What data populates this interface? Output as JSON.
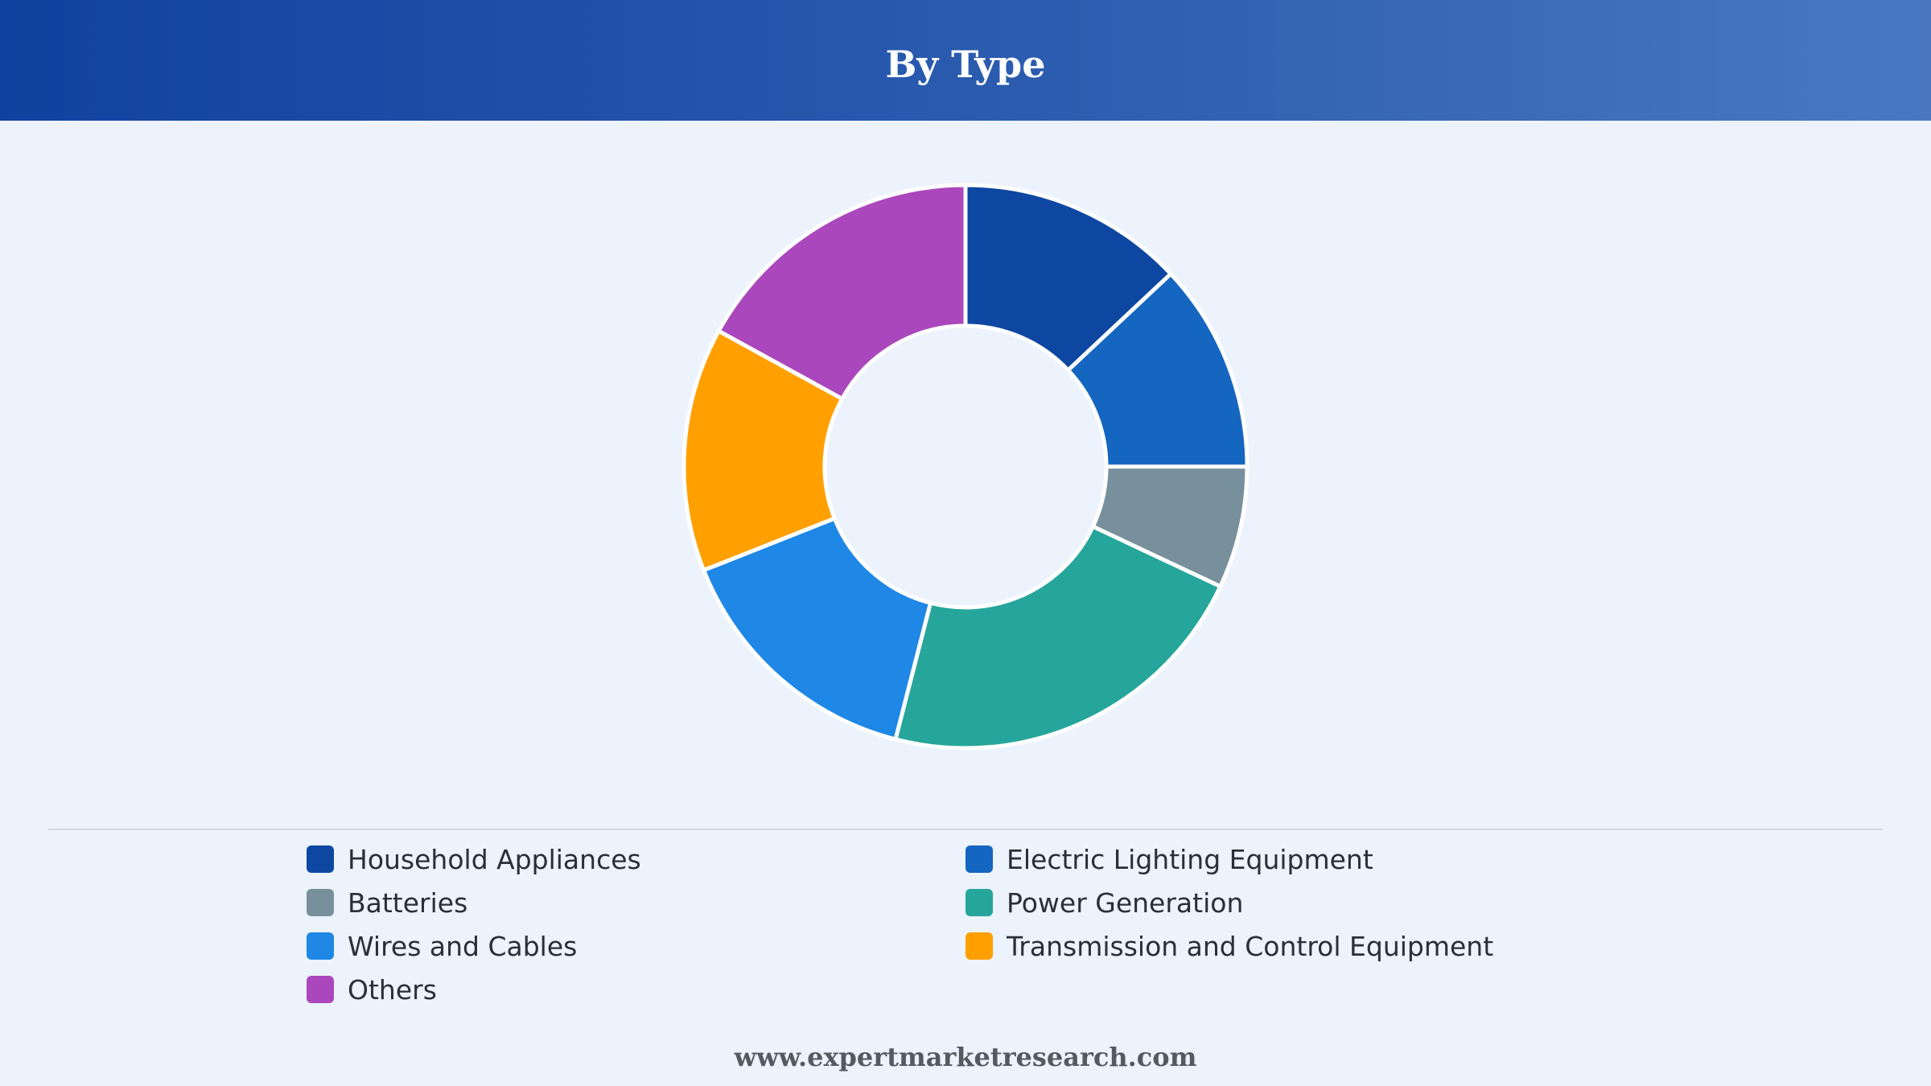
{
  "header": {
    "title": "By Type"
  },
  "chart_data": {
    "type": "pie",
    "title": "By Type",
    "donut": true,
    "legend_position": "bottom",
    "categories": [
      "Household Appliances",
      "Electric Lighting Equipment",
      "Batteries",
      "Power Generation",
      "Wires and Cables",
      "Transmission and Control Equipment",
      "Others"
    ],
    "values": [
      13,
      12,
      7,
      22,
      15,
      14,
      17
    ],
    "colors": [
      "#0e47a1",
      "#1566c0",
      "#78909c",
      "#26a69a",
      "#1f87e5",
      "#ffa000",
      "#ab47bc"
    ]
  },
  "footer": {
    "url": "www.expertmarketresearch.com"
  }
}
